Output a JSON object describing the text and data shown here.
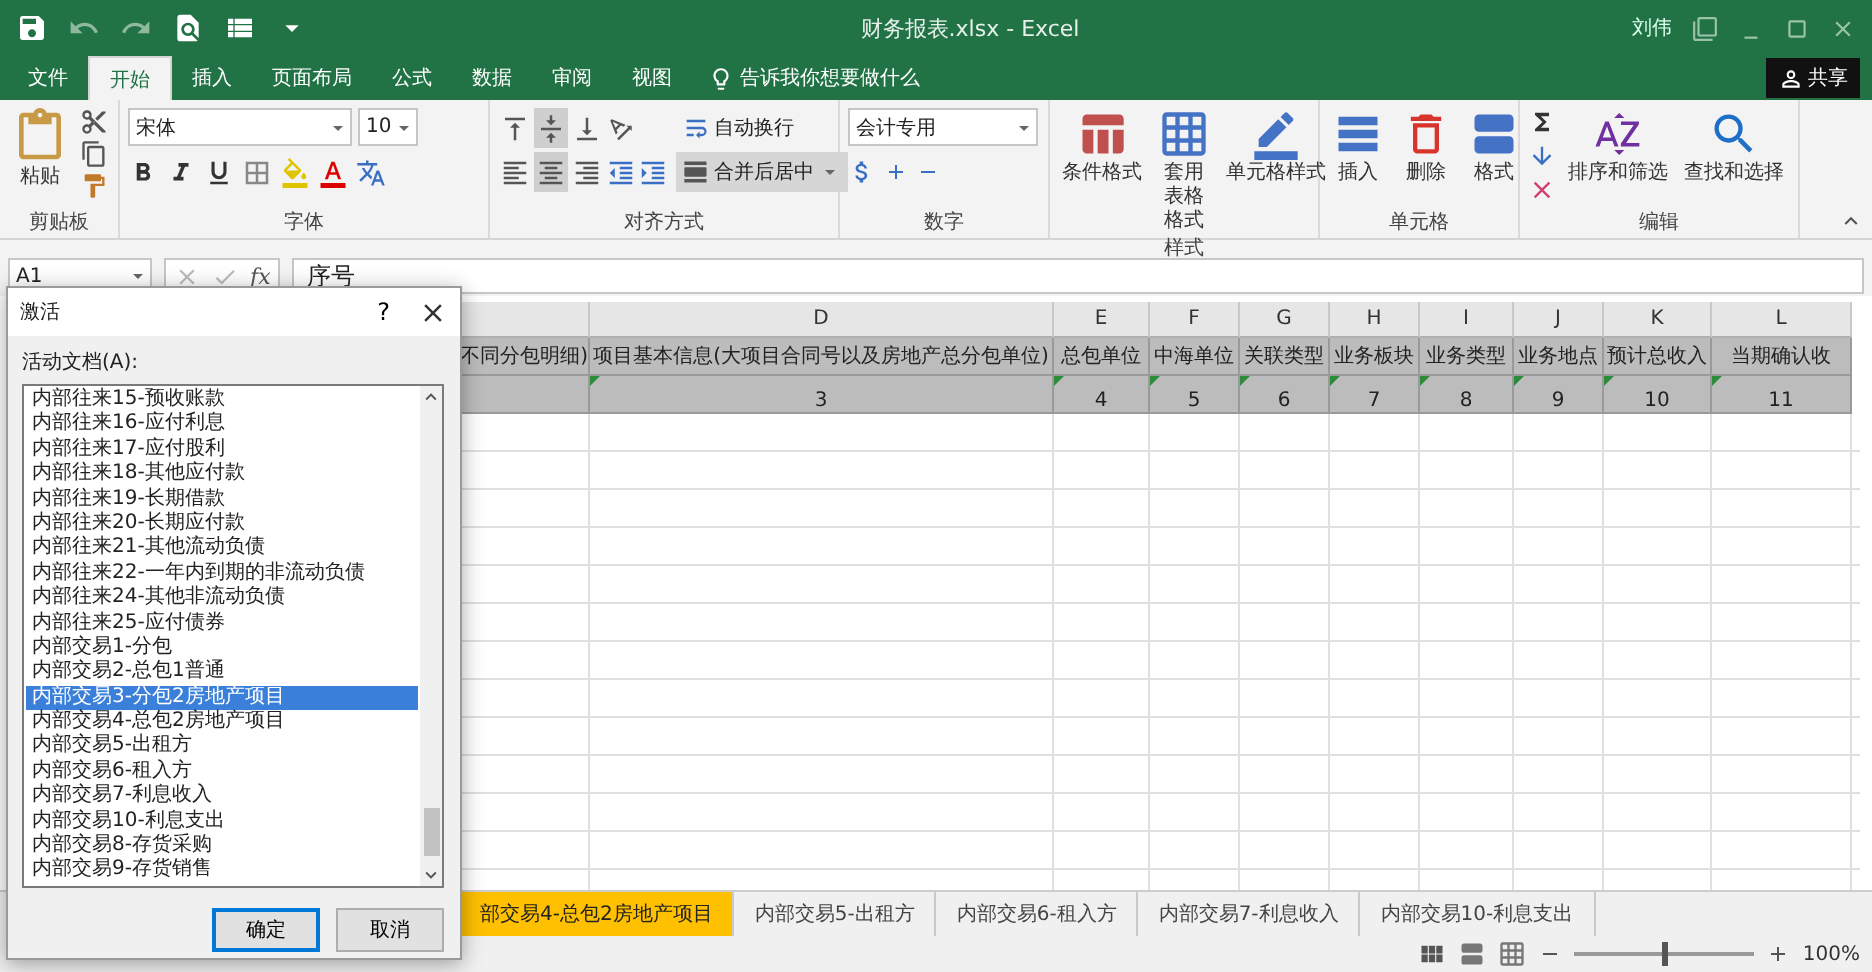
{
  "title_bar": {
    "document_title": "财务报表.xlsx  -  Excel",
    "user": "刘伟"
  },
  "ribbon_tabs": [
    {
      "label": "文件",
      "selected": false
    },
    {
      "label": "开始",
      "selected": true
    },
    {
      "label": "插入",
      "selected": false
    },
    {
      "label": "页面布局",
      "selected": false
    },
    {
      "label": "公式",
      "selected": false
    },
    {
      "label": "数据",
      "selected": false
    },
    {
      "label": "审阅",
      "selected": false
    },
    {
      "label": "视图",
      "selected": false
    }
  ],
  "tell_me": {
    "placeholder": "告诉我你想要做什么"
  },
  "share_button": "共享",
  "ribbon": {
    "clipboard": {
      "paste": "粘贴",
      "group": "剪贴板"
    },
    "font": {
      "font_name": "宋体",
      "font_size": "10",
      "group": "字体"
    },
    "alignment": {
      "vertical": [
        {
          "kind": "top",
          "selected": false
        },
        {
          "kind": "middle",
          "selected": true
        },
        {
          "kind": "bottom",
          "selected": false
        }
      ],
      "horizontal": [
        {
          "kind": "left",
          "selected": false
        },
        {
          "kind": "center",
          "selected": true
        },
        {
          "kind": "right",
          "selected": false
        }
      ],
      "wrap_text": {
        "label": "自动换行",
        "on": false
      },
      "merge": {
        "label": "合并后居中",
        "on": true
      },
      "group": "对齐方式"
    },
    "number": {
      "format": "会计专用",
      "group": "数字"
    },
    "styles": {
      "buttons": [
        {
          "kind": "conditional",
          "label": "条件格式"
        },
        {
          "kind": "table",
          "label": "套用表格格式"
        },
        {
          "kind": "cell",
          "label": "单元格样式"
        }
      ],
      "group": "样式"
    },
    "cells": {
      "buttons": [
        {
          "kind": "insert",
          "label": "插入"
        },
        {
          "kind": "delete",
          "label": "删除"
        },
        {
          "kind": "format",
          "label": "格式"
        }
      ],
      "group": "单元格"
    },
    "editing": {
      "buttons": [
        {
          "kind": "sort",
          "label": "排序和筛选"
        },
        {
          "kind": "find",
          "label": "查找和选择"
        }
      ],
      "group": "编辑"
    }
  },
  "formula_bar": {
    "name_box": "A1",
    "function_label": "fx",
    "content": "序号"
  },
  "sheet": {
    "partial_column": {
      "title": "不同分包明细)"
    },
    "columns": [
      {
        "letter": "D",
        "title": "项目基本信息(大项目合同号以及房地产总分包单位)",
        "index": "3",
        "flagged": true
      },
      {
        "letter": "E",
        "title": "总包单位",
        "index": "4",
        "flagged": true
      },
      {
        "letter": "F",
        "title": "中海单位",
        "index": "5",
        "flagged": true
      },
      {
        "letter": "G",
        "title": "关联类型",
        "index": "6",
        "flagged": true
      },
      {
        "letter": "H",
        "title": "业务板块",
        "index": "7",
        "flagged": true
      },
      {
        "letter": "I",
        "title": "业务类型",
        "index": "8",
        "flagged": true
      },
      {
        "letter": "J",
        "title": "业务地点",
        "index": "9",
        "flagged": true
      },
      {
        "letter": "K",
        "title": "预计总收入",
        "index": "10",
        "flagged": true
      },
      {
        "letter": "L",
        "title": "当期确认收",
        "index": "11",
        "flagged": true
      }
    ]
  },
  "sheet_tabs": [
    {
      "label": "部交易4-总包2房地产项目",
      "selected": true
    },
    {
      "label": "内部交易5-出租方",
      "selected": false
    },
    {
      "label": "内部交易6-租入方",
      "selected": false
    },
    {
      "label": "内部交易7-利息收入",
      "selected": false
    },
    {
      "label": "内部交易10-利息支出",
      "selected": false
    }
  ],
  "status_bar": {
    "zoom": "100%",
    "zoom_slider": {
      "level": 0.5
    }
  },
  "dialog": {
    "title": "激活",
    "help": "?",
    "list_label": "活动文档(A):",
    "items": [
      {
        "label": "内部往来15-预收账款",
        "selected": false
      },
      {
        "label": "内部往来16-应付利息",
        "selected": false
      },
      {
        "label": "内部往来17-应付股利",
        "selected": false
      },
      {
        "label": "内部往来18-其他应付款",
        "selected": false
      },
      {
        "label": "内部往来19-长期借款",
        "selected": false
      },
      {
        "label": "内部往来20-长期应付款",
        "selected": false
      },
      {
        "label": "内部往来21-其他流动负债",
        "selected": false
      },
      {
        "label": "内部往来22-一年内到期的非流动负债",
        "selected": false
      },
      {
        "label": "内部往来24-其他非流动负债",
        "selected": false
      },
      {
        "label": "内部往来25-应付债券",
        "selected": false
      },
      {
        "label": "内部交易1-分包",
        "selected": false
      },
      {
        "label": "内部交易2-总包1普通",
        "selected": false
      },
      {
        "label": "内部交易3-分包2房地产项目",
        "selected": true
      },
      {
        "label": "内部交易4-总包2房地产项目",
        "selected": false
      },
      {
        "label": "内部交易5-出租方",
        "selected": false
      },
      {
        "label": "内部交易6-租入方",
        "selected": false
      },
      {
        "label": "内部交易7-利息收入",
        "selected": false
      },
      {
        "label": "内部交易10-利息支出",
        "selected": false
      },
      {
        "label": "内部交易8-存货采购",
        "selected": false
      },
      {
        "label": "内部交易9-存货销售",
        "selected": false
      }
    ],
    "ok": "确定",
    "cancel": "取消"
  }
}
